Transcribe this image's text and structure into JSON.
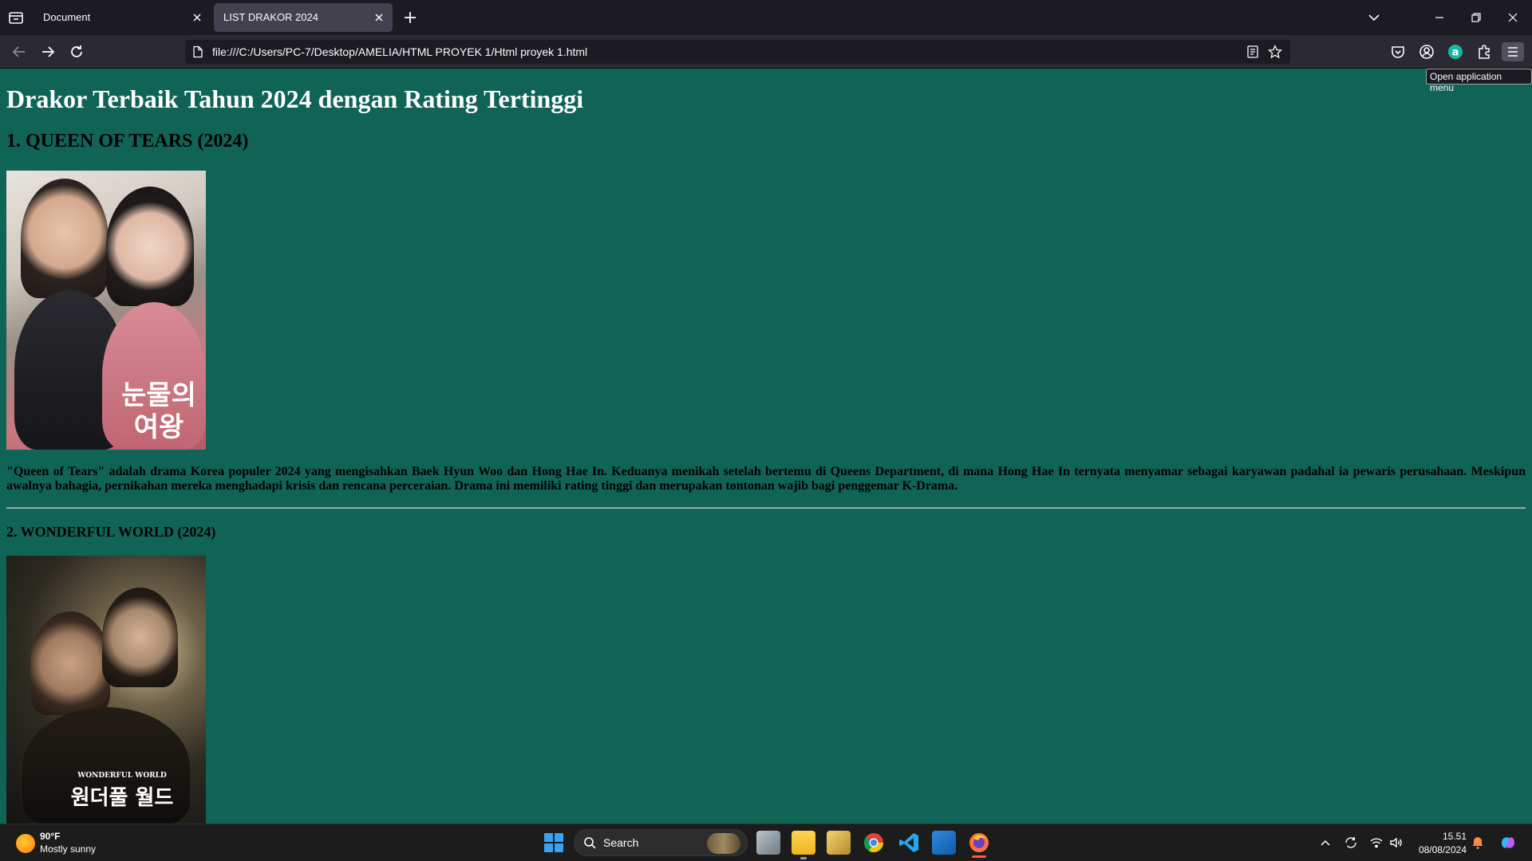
{
  "browser": {
    "tabs": [
      {
        "title": "Document",
        "active": false
      },
      {
        "title": "LIST DRAKOR 2024",
        "active": true
      }
    ],
    "url": "file:///C:/Users/PC-7/Desktop/AMELIA/HTML PROYEK 1/Html proyek 1.html",
    "tooltip": "Open application menu"
  },
  "page": {
    "title": "Drakor Terbaik Tahun 2024 dengan Rating Tertinggi",
    "items": [
      {
        "heading": "1. QUEEN OF TEARS (2024)",
        "poster_text": "눈물의 여왕",
        "description": "\"Queen of Tears\" adalah drama Korea populer 2024 yang mengisahkan Baek Hyun Woo dan Hong Hae In. Keduanya menikah setelah bertemu di Queens Department, di mana Hong Hae In ternyata menyamar sebagai karyawan padahal ia pewaris perusahaan. Meskipun awalnya bahagia, pernikahan mereka menghadapi krisis dan rencana perceraian. Drama ini memiliki rating tinggi dan merupakan tontonan wajib bagi penggemar K-Drama."
      },
      {
        "heading": "2. WONDERFUL WORLD (2024)",
        "poster_text": "원더풀 월드",
        "poster_subtitle": "WONDERFUL WORLD"
      }
    ]
  },
  "taskbar": {
    "weather_temp": "90°F",
    "weather_desc": "Mostly sunny",
    "search_label": "Search",
    "time": "15.51",
    "date": "08/08/2024"
  },
  "colors": {
    "page_background": "#106456",
    "title_color": "#ffffff",
    "body_text": "#000000"
  }
}
